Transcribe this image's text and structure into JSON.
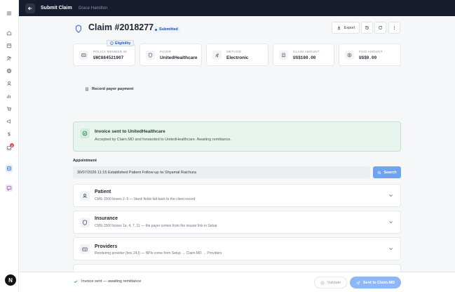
{
  "topbar": {
    "title": "Submit Claim",
    "user": "Grace Hamilton"
  },
  "header": {
    "claim_title": "Claim #2018277",
    "status": "Submitted",
    "export_label": "Export"
  },
  "eligibility_label": "Eligibility",
  "cards": [
    {
      "label": "POLICY MEMBER ID",
      "value": "UHC884521907",
      "icon": "id-card-icon"
    },
    {
      "label": "PAYER",
      "value": "UnitedHealthcare",
      "icon": "shield-icon"
    },
    {
      "label": "METHOD",
      "value": "Electronic",
      "icon": "plug-icon"
    },
    {
      "label": "CLAIM AMOUNT",
      "value": "US$180.00",
      "icon": "receipt-icon"
    },
    {
      "label": "PAID AMOUNT",
      "value": "US$0.00",
      "icon": "dollar-icon"
    }
  ],
  "record_payment_label": "Record payer payment",
  "banner": {
    "title": "Invoice sent to UnitedHealthcare",
    "description": "Accepted by Claim.MD and forwarded to UnitedHealthcare. Awaiting remittance."
  },
  "appointment": {
    "label": "Appointment",
    "value": "30/07/2026 11:15 Established Patient Follow-up /w Shyamal Raichura",
    "search_label": "Search"
  },
  "sections": [
    {
      "title": "Patient",
      "description": "CMS-1500 boxes 2–5 — blank fields fall back to the client record",
      "icon": "user-icon"
    },
    {
      "title": "Insurance",
      "description": "CMS-1500 boxes 1a, 4, 7, 11 — the payer comes from the insurer link in Setup",
      "icon": "shield-icon"
    },
    {
      "title": "Providers",
      "description": "Rendering provider (box 24J) — NPIs come from Setup → Claim.MD → Providers",
      "icon": "id-card-icon"
    }
  ],
  "footer": {
    "status": "Invoice sent — awaiting remittance",
    "validate_label": "Validate",
    "sent_label": "Sent to Claim.MD"
  },
  "rail": {
    "notification_count": "2",
    "avatar_letter": "N"
  },
  "colors": {
    "topbar": "#161b2e",
    "accent": "#3b6fd6",
    "success": "#2f9e5b",
    "banner_bg": "#e8f5ee"
  }
}
